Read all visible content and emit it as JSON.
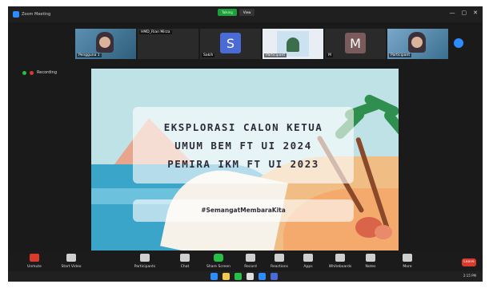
{
  "window": {
    "app_title": "Zoom Meeting",
    "top_pills": [
      "Talking",
      "View"
    ],
    "controls": [
      "—",
      "▢",
      "✕"
    ]
  },
  "gallery": {
    "tiles": [
      {
        "kind": "video",
        "name": "Pengguna 1"
      },
      {
        "kind": "avatar",
        "initial": "",
        "name": "HMD_Rian Mirza"
      },
      {
        "kind": "avatar",
        "initial": "S",
        "name": "Sakih"
      },
      {
        "kind": "image",
        "name": "Participant"
      },
      {
        "kind": "avatar",
        "initial": "M",
        "name": "M"
      },
      {
        "kind": "video",
        "name": "Participant"
      }
    ],
    "next_page_icon": "chevron-right-icon"
  },
  "view": {
    "label": "Recording"
  },
  "slide": {
    "title_lines": [
      "EKSPLORASI CALON KETUA",
      "UMUM BEM FT UI 2024",
      "PEMIRA IKM FT UI 2023"
    ],
    "hashtag": "#SemangatMembaraKita"
  },
  "toolbar": {
    "items": [
      {
        "label": "Unmute",
        "icon": "microphone-icon"
      },
      {
        "label": "Start Video",
        "icon": "video-icon"
      },
      {
        "label": "Participants",
        "icon": "participants-icon"
      },
      {
        "label": "Chat",
        "icon": "chat-icon"
      },
      {
        "label": "Share Screen",
        "icon": "share-screen-icon"
      },
      {
        "label": "Record",
        "icon": "record-icon"
      },
      {
        "label": "Reactions",
        "icon": "reactions-icon"
      },
      {
        "label": "Apps",
        "icon": "apps-icon"
      },
      {
        "label": "Whiteboards",
        "icon": "whiteboard-icon"
      },
      {
        "label": "Notes",
        "icon": "notes-icon"
      },
      {
        "label": "More",
        "icon": "more-icon"
      }
    ],
    "leave_label": "Leave"
  },
  "taskbar": {
    "tray_text": "2:15 PM"
  },
  "colors": {
    "zoom_blue": "#2d8cff",
    "share_green": "#27c046",
    "leave_red": "#d83b2b",
    "avatar_s": "#4a6ad6",
    "avatar_m": "#7a5a5a"
  }
}
